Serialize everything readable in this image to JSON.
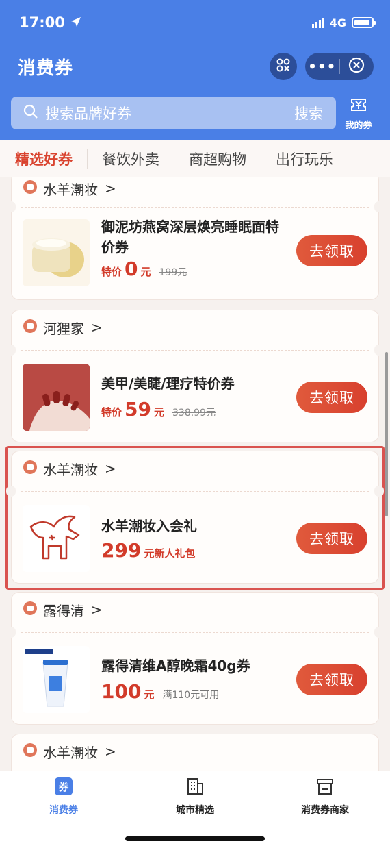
{
  "status": {
    "time": "17:00",
    "network": "4G"
  },
  "title": "消费券",
  "search": {
    "placeholder": "搜索品牌好券",
    "button": "搜索"
  },
  "my_coupon_label": "我的券",
  "tabs": [
    {
      "label": "精选好券",
      "active": true
    },
    {
      "label": "餐饮外卖",
      "active": false
    },
    {
      "label": "商超购物",
      "active": false
    },
    {
      "label": "出行玩乐",
      "active": false
    }
  ],
  "cards": [
    {
      "shop": "水羊潮妆",
      "title": "御泥坊燕窝深层焕亮睡眠面特价券",
      "price_tag": "特价",
      "price": "0",
      "unit": "元",
      "original": "199元",
      "button": "去领取",
      "thumb": "cream-jar-image"
    },
    {
      "shop": "河狸家",
      "title": "美甲/美睫/理疗特价券",
      "price_tag": "特价",
      "price": "59",
      "unit": "元",
      "original": "338.99元",
      "button": "去领取",
      "thumb": "manicure-image"
    },
    {
      "shop": "水羊潮妆",
      "title": "水羊潮妆入会礼",
      "price": "299",
      "unit": "元新人礼包",
      "button": "去领取",
      "thumb": "goat-logo"
    },
    {
      "shop": "露得清",
      "title": "露得清维A醇晚霜40g券",
      "price": "100",
      "unit": "元",
      "note": "满110元可用",
      "button": "去领取",
      "thumb": "cream-tube-image"
    },
    {
      "shop": "水羊潮妆"
    }
  ],
  "bottom_nav": [
    {
      "label": "消费券",
      "active": true,
      "icon": "coupon-icon"
    },
    {
      "label": "城市精选",
      "active": false,
      "icon": "building-icon"
    },
    {
      "label": "消费券商家",
      "active": false,
      "icon": "store-icon"
    }
  ],
  "thumb_badge_text": "券",
  "colors": {
    "brand_blue": "#4a7fe6",
    "accent_red": "#d9432f",
    "highlight_border": "#d9534f"
  }
}
